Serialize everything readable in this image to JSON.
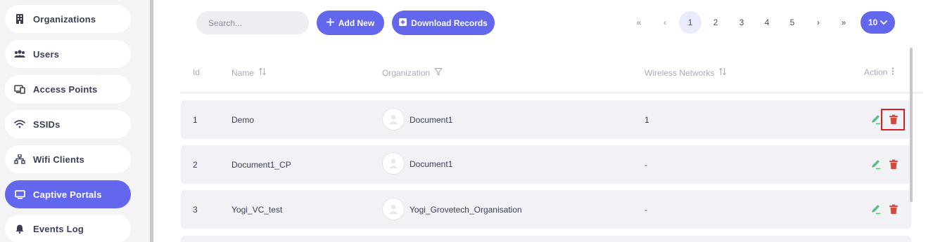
{
  "sidebar": {
    "items": [
      {
        "label": "Organizations",
        "icon": "building-icon",
        "active": false
      },
      {
        "label": "Users",
        "icon": "users-icon",
        "active": false
      },
      {
        "label": "Access Points",
        "icon": "devices-icon",
        "active": false
      },
      {
        "label": "SSIDs",
        "icon": "wifi-icon",
        "active": false
      },
      {
        "label": "Wifi Clients",
        "icon": "network-icon",
        "active": false
      },
      {
        "label": "Captive Portals",
        "icon": "monitor-icon",
        "active": true
      },
      {
        "label": "Events Log",
        "icon": "bell-icon",
        "active": false
      }
    ]
  },
  "toolbar": {
    "search_placeholder": "Search...",
    "add_label": "Add New",
    "download_label": "Download Records"
  },
  "pagination": {
    "first": "«",
    "prev": "‹",
    "pages": [
      "1",
      "2",
      "3",
      "4",
      "5"
    ],
    "current_page": "1",
    "next": "›",
    "last": "»",
    "page_size": "10"
  },
  "table": {
    "headers": {
      "id": "Id",
      "name": "Name",
      "organization": "Organization",
      "wireless_networks": "Wireless Networks",
      "action": "Action"
    },
    "rows": [
      {
        "id": "1",
        "name": "Demo",
        "organization": "Document1",
        "wireless_networks": "1"
      },
      {
        "id": "2",
        "name": "Document1_CP",
        "organization": "Document1",
        "wireless_networks": "-"
      },
      {
        "id": "3",
        "name": "Yogi_VC_test",
        "organization": "Yogi_Grovetech_Organisation",
        "wireless_networks": "-"
      }
    ]
  },
  "colors": {
    "accent": "#6267ee",
    "edit": "#58c27d",
    "delete": "#d24b3e",
    "highlight": "#d91f26"
  }
}
